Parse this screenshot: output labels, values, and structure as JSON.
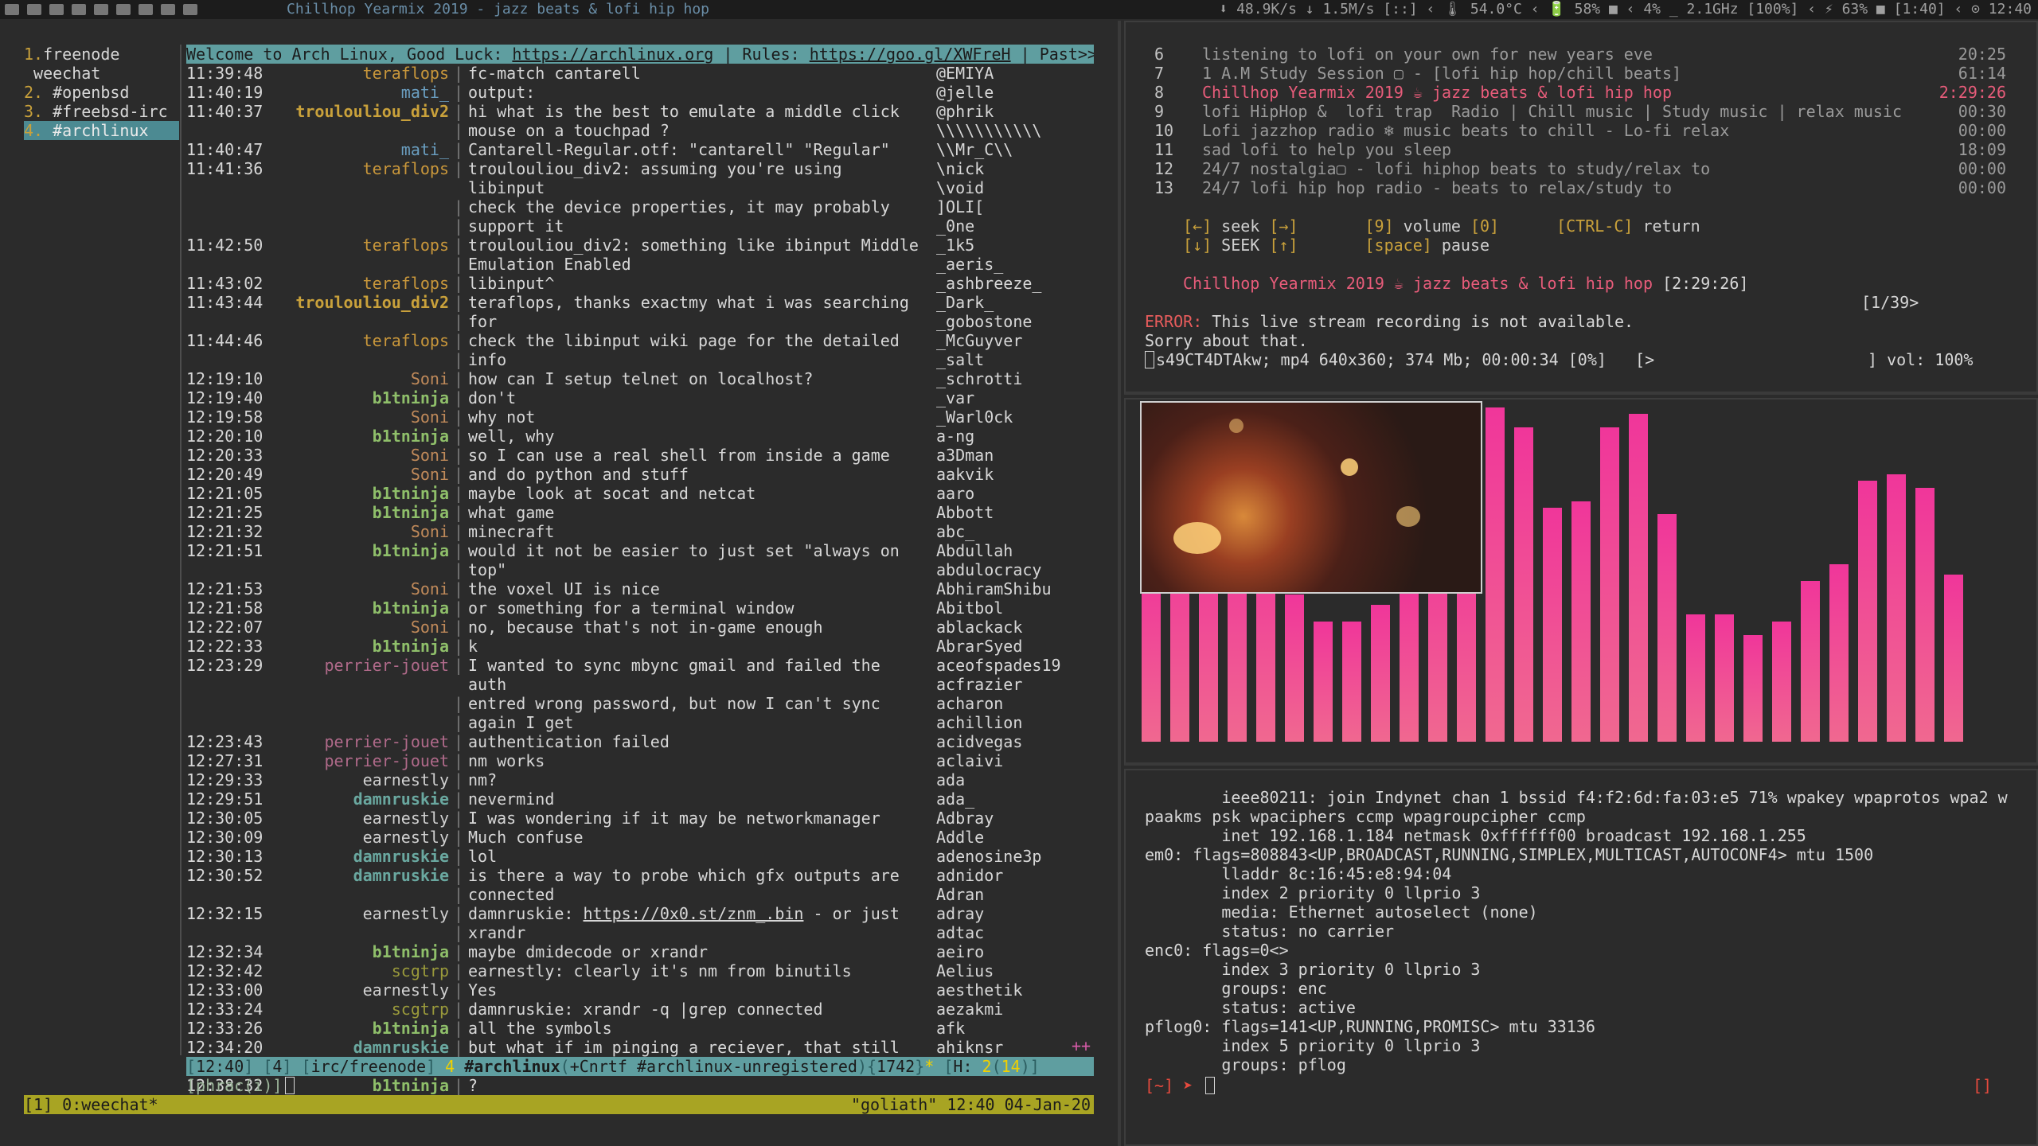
{
  "topbar": {
    "window_title": "Chillhop Yearmix 2019 - jazz beats & lofi hip hop",
    "status": "⬇ 48.9K/s ↓ 1.5M/s [::] ‹ 🌡 54.0°C ‹ 🔋 58% ■ ‹ 4% _ 2.1GHz [100%] ‹ ⚡ 63% ■ [1:40] ‹ ⊙ 12:40"
  },
  "weechat": {
    "buffers": [
      {
        "num": "1.",
        "name": "freenode"
      },
      {
        "num": "",
        "name": " weechat"
      },
      {
        "num": "2.",
        "name": " #openbsd"
      },
      {
        "num": "3.",
        "name": " #freebsd-irc"
      },
      {
        "num": "4.",
        "name": " #archlinux"
      }
    ],
    "title": {
      "prefix": "Welcome to Arch Linux, Good Luck: ",
      "link1": "https://archlinux.org",
      "mid": " | Rules: ",
      "link2": "https://goo.gl/XWFreH",
      "suffix": " | Past>>"
    },
    "messages": [
      {
        "t": "11:39:48",
        "n": "teraflops",
        "c": "#c9973b",
        "tx": "fc-match cantarell"
      },
      {
        "t": "11:40:19",
        "n": "mati_",
        "c": "#6a9ec0",
        "tx": "output:"
      },
      {
        "t": "11:40:37",
        "n": "troulouliou_div2",
        "c": "#c9a13b",
        "b": true,
        "tx": "hi what is the best to emulate a middle click"
      },
      {
        "cont": true,
        "tx": "mouse on a touchpad ?"
      },
      {
        "t": "11:40:47",
        "n": "mati_",
        "c": "#6a9ec0",
        "tx": "Cantarell-Regular.otf: \"cantarell\" \"Regular\""
      },
      {
        "t": "11:41:36",
        "n": "teraflops",
        "c": "#c9973b",
        "tx": "troulouliou_div2: assuming you're using libinput"
      },
      {
        "cont": true,
        "tx": "check the device properties, it may probably"
      },
      {
        "cont": true,
        "tx": "support it"
      },
      {
        "t": "11:42:50",
        "n": "teraflops",
        "c": "#c9973b",
        "tx": "troulouliou_div2: something like ibinput Middle"
      },
      {
        "cont": true,
        "tx": "Emulation Enabled"
      },
      {
        "t": "11:43:02",
        "n": "teraflops",
        "c": "#c9973b",
        "tx": "libinput^"
      },
      {
        "t": "11:43:44",
        "n": "troulouliou_div2",
        "c": "#c9a13b",
        "b": true,
        "tx": "teraflops, thanks exactmy what i was searching"
      },
      {
        "cont": true,
        "tx": "for"
      },
      {
        "t": "11:44:46",
        "n": "teraflops",
        "c": "#c9973b",
        "tx": "check the libinput wiki page for the detailed"
      },
      {
        "cont": true,
        "tx": "info"
      },
      {
        "t": "12:19:10",
        "n": "Soni",
        "c": "#c08a5a",
        "tx": "how can I setup telnet on localhost?"
      },
      {
        "t": "12:19:40",
        "n": "b1tninja",
        "c": "#8fbf6a",
        "b": true,
        "tx": "don't"
      },
      {
        "t": "12:19:58",
        "n": "Soni",
        "c": "#c08a5a",
        "tx": "why not"
      },
      {
        "t": "12:20:10",
        "n": "b1tninja",
        "c": "#8fbf6a",
        "b": true,
        "tx": "well, why"
      },
      {
        "t": "12:20:33",
        "n": "Soni",
        "c": "#c08a5a",
        "tx": "so I can use a real shell from inside a game"
      },
      {
        "t": "12:20:49",
        "n": "Soni",
        "c": "#c08a5a",
        "tx": "and do python and stuff"
      },
      {
        "t": "12:21:05",
        "n": "b1tninja",
        "c": "#8fbf6a",
        "b": true,
        "tx": "maybe look at socat and netcat"
      },
      {
        "t": "12:21:25",
        "n": "b1tninja",
        "c": "#8fbf6a",
        "b": true,
        "tx": "what game"
      },
      {
        "t": "12:21:32",
        "n": "Soni",
        "c": "#c08a5a",
        "tx": "minecraft"
      },
      {
        "t": "12:21:51",
        "n": "b1tninja",
        "c": "#8fbf6a",
        "b": true,
        "tx": "would it not be easier to just set \"always on"
      },
      {
        "cont": true,
        "tx": "top\""
      },
      {
        "t": "12:21:53",
        "n": "Soni",
        "c": "#c08a5a",
        "tx": "the voxel UI is nice"
      },
      {
        "t": "12:21:58",
        "n": "b1tninja",
        "c": "#8fbf6a",
        "b": true,
        "tx": "or something for a terminal window"
      },
      {
        "t": "12:22:07",
        "n": "Soni",
        "c": "#c08a5a",
        "tx": "no, because that's not in-game enough"
      },
      {
        "t": "12:22:33",
        "n": "b1tninja",
        "c": "#8fbf6a",
        "b": true,
        "tx": "k"
      },
      {
        "t": "12:23:29",
        "n": "perrier-jouet",
        "c": "#b06a8a",
        "tx": "I wanted to sync mbync gmail and failed the auth"
      },
      {
        "cont": true,
        "tx": "entred wrong password, but now I can't sync"
      },
      {
        "cont": true,
        "tx": "again I get"
      },
      {
        "t": "12:23:43",
        "n": "perrier-jouet",
        "c": "#b06a8a",
        "tx": "authentication failed"
      },
      {
        "t": "12:27:31",
        "n": "perrier-jouet",
        "c": "#b06a8a",
        "tx": "nm works"
      },
      {
        "t": "12:29:33",
        "n": "earnestly",
        "c": "#d0d0d0",
        "tx": "nm?"
      },
      {
        "t": "12:29:51",
        "n": "damnruskie",
        "c": "#6aa8a0",
        "b": true,
        "tx": "nevermind"
      },
      {
        "t": "12:30:05",
        "n": "earnestly",
        "c": "#d0d0d0",
        "tx": "I was wondering if it may be networkmanager"
      },
      {
        "t": "12:30:09",
        "n": "earnestly",
        "c": "#d0d0d0",
        "tx": "Much confuse"
      },
      {
        "t": "12:30:13",
        "n": "damnruskie",
        "c": "#6aa8a0",
        "b": true,
        "tx": "lol"
      },
      {
        "t": "12:30:52",
        "n": "damnruskie",
        "c": "#6aa8a0",
        "b": true,
        "tx": "is there a way to probe which gfx outputs are"
      },
      {
        "cont": true,
        "tx": "connected"
      },
      {
        "t": "12:32:15",
        "n": "earnestly",
        "c": "#d0d0d0",
        "tx": "damnruskie: https://0x0.st/znm_.bin - or just"
      },
      {
        "cont": true,
        "tx": "xrandr"
      },
      {
        "t": "12:32:34",
        "n": "b1tninja",
        "c": "#8fbf6a",
        "b": true,
        "tx": "maybe dmidecode or xrandr"
      },
      {
        "t": "12:32:42",
        "n": "scgtrp",
        "c": "#9a9a3b",
        "tx": "earnestly: clearly it's nm from binutils"
      },
      {
        "t": "12:33:00",
        "n": "earnestly",
        "c": "#d0d0d0",
        "tx": "Yes"
      },
      {
        "t": "12:33:24",
        "n": "scgtrp",
        "c": "#9a9a3b",
        "tx": "damnruskie: xrandr -q |grep connected"
      },
      {
        "t": "12:33:26",
        "n": "b1tninja",
        "c": "#8fbf6a",
        "b": true,
        "tx": "all the symbols"
      },
      {
        "t": "12:34:20",
        "n": "damnruskie",
        "c": "#6aa8a0",
        "b": true,
        "tx": "but what if im pinging a reciever, that still"
      },
      {
        "cont": true,
        "tx": "works right"
      },
      {
        "t": "12:38:32",
        "n": "b1tninja",
        "c": "#8fbf6a",
        "b": true,
        "tx": "?"
      }
    ],
    "nicks": [
      "@EMIYA",
      "@jelle",
      "@phrik",
      "\\\\\\\\\\\\\\\\\\\\\\",
      "\\\\Mr_C\\\\",
      "\\nick",
      "\\void",
      "]OLI[",
      "_0ne",
      "_1k5",
      "_aeris_",
      "_ashbreeze_",
      "_Dark_",
      "_gobostone",
      "_McGuyver",
      "_salt",
      "_schrotti",
      "_var",
      "_Warl0ck",
      "a-ng",
      "a3Dman",
      "aakvik",
      "aaro",
      "Abbott",
      "abc_",
      "Abdullah",
      "abdulocracy",
      "AbhiramShibu",
      "Abitbol",
      "ablackack",
      "AbrarSyed",
      "aceofspades19",
      "acfrazier",
      "acharon",
      "achillion",
      "acidvegas",
      "aclaivi",
      "ada",
      "ada_",
      "Adbray",
      "Addle",
      "adenosine3p",
      "adnidor",
      "Adran",
      "adray",
      "adtac",
      "aeiro",
      "Aelius",
      "aesthetik",
      "aezakmi",
      "afk",
      "ahiknsr"
    ],
    "more_indicator": "++",
    "status": {
      "time": "12:40",
      "win": "4",
      "server": "irc/freenode",
      "chan_num": "4",
      "chan": "#archlinux",
      "modes": "+Cnrtf #archlinux-unregistered",
      "users": "1742",
      "star": "*",
      "hot_label": "H:",
      "hot_a": "2",
      "hot_b": "14"
    },
    "input_prefix": "[phrac(i)]"
  },
  "tmux": {
    "left": "[1] 0:weechat*",
    "right": "\"goliath\" 12:40 04-Jan-20"
  },
  "mpv": {
    "playlist": [
      {
        "i": "6",
        "title": "listening to lofi on your own for new years eve",
        "dur": "20:25"
      },
      {
        "i": "7",
        "title": "1 A.M Study Session ▢ - [lofi hip hop/chill beats]",
        "dur": "61:14"
      },
      {
        "i": "8",
        "title": "Chillhop Yearmix 2019 ☕ jazz beats & lofi hip hop",
        "dur": "2:29:26",
        "cur": true
      },
      {
        "i": "9",
        "title": "lofi HipHop &  lofi trap  Radio | Chill music | Study music | relax music",
        "dur": "00:30"
      },
      {
        "i": "10",
        "title": "Lofi jazzhop radio ❄ music beats to chill - Lo-fi relax",
        "dur": "00:00"
      },
      {
        "i": "11",
        "title": "sad lofi to help you sleep",
        "dur": "18:09"
      },
      {
        "i": "12",
        "title": "24/7 nostalgia▢ - lofi hiphop beats to study/relax to",
        "dur": "00:00"
      },
      {
        "i": "13",
        "title": "24/7 lofi hip hop radio - beats to relax/study to",
        "dur": "00:00"
      }
    ],
    "hints": {
      "row1": {
        "k1": "[←]",
        "a1": " seek ",
        "k2": "[→]",
        "k3": "[9]",
        "a2": " volume ",
        "k4": "[0]",
        "k5": "[CTRL-C]",
        "a3": " return"
      },
      "row2": {
        "k1": "[↓]",
        "a1": " SEEK ",
        "k2": "[↑]",
        "k3": "[space]",
        "a2": " pause"
      }
    },
    "now_playing_title": "Chillhop Yearmix 2019 ☕ jazz beats & lofi hip hop",
    "now_playing_dur": "[2:29:26]",
    "position": "[1/39>",
    "error_label": "ERROR:",
    "error_msg": " This live stream recording is not available.",
    "error_msg2": "Sorry about that.",
    "file_line": "s49CT4DTAkw; mp4 640x360; 374 Mb; 00:00:34 [0%]   [>",
    "volume": "] vol: 100%"
  },
  "visualizer": {
    "levels": [
      0.51,
      0.6,
      0.6,
      0.6,
      0.6,
      0.44,
      0.36,
      0.36,
      0.41,
      0.48,
      0.6,
      0.6,
      1.0,
      0.94,
      0.7,
      0.72,
      0.94,
      0.98,
      0.68,
      0.38,
      0.38,
      0.32,
      0.36,
      0.48,
      0.53,
      0.78,
      0.8,
      0.76,
      0.5
    ],
    "bar_color_top": "#f0369a",
    "bar_color_bottom": "#f06890"
  },
  "terminal": {
    "lines": [
      "        ieee80211: join Indynet chan 1 bssid f4:f2:6d:fa:03:e5 71% wpakey wpaprotos wpa2 w",
      "paakms psk wpaciphers ccmp wpagroupcipher ccmp",
      "        inet 192.168.1.184 netmask 0xffffff00 broadcast 192.168.1.255",
      "em0: flags=808843<UP,BROADCAST,RUNNING,SIMPLEX,MULTICAST,AUTOCONF4> mtu 1500",
      "        lladdr 8c:16:45:e8:94:04",
      "        index 2 priority 0 llprio 3",
      "        media: Ethernet autoselect (none)",
      "        status: no carrier",
      "enc0: flags=0<>",
      "        index 3 priority 0 llprio 3",
      "        groups: enc",
      "        status: active",
      "pflog0: flags=141<UP,RUNNING,PROMISC> mtu 33136",
      "        index 5 priority 0 llprio 3",
      "        groups: pflog"
    ],
    "prompt_dir": "[~]",
    "prompt_arrow": " ➤ ",
    "prompt_right": "[]"
  }
}
